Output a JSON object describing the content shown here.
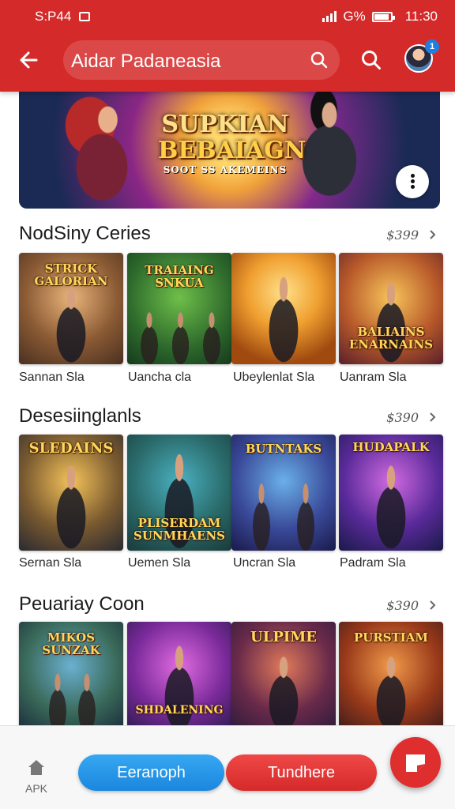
{
  "status_bar": {
    "carrier": "S:P44",
    "time": "11:30",
    "battery": "G%"
  },
  "search": {
    "value": "Aidar Padaneasia"
  },
  "profile": {
    "notification_count": "1"
  },
  "banner": {
    "title_line1": "SUPKIAN",
    "title_line2": "BEBAIAGN",
    "title_line3": "SOOT SS AKEMEINS"
  },
  "sections": [
    {
      "title": "NodSiny Ceries",
      "price": "$399",
      "items": [
        {
          "art_text": "STRICK GALORIAN",
          "caption": "Sannan Sla"
        },
        {
          "art_text": "TRAIAING SNKUA",
          "caption": "Uancha cla"
        },
        {
          "art_text": "",
          "caption": "Ubeylenlat Sla"
        },
        {
          "art_text": "BALIAINS ENARNAINS",
          "caption": "Uanram Sla"
        }
      ]
    },
    {
      "title": "Desesiinglanls",
      "price": "$390",
      "items": [
        {
          "art_text": "SLEDAINS",
          "caption": "Sernan Sla"
        },
        {
          "art_text": "PLISERDAM SUNMHAENS",
          "caption": "Uemen Sla"
        },
        {
          "art_text": "BUTNTAKS",
          "caption": "Uncran Sla"
        },
        {
          "art_text": "HUDAPALK",
          "caption": "Padram Sla"
        }
      ]
    },
    {
      "title": "Peuariay Coon",
      "price": "$390",
      "items": [
        {
          "art_text": "MIKOS SUNZAK",
          "caption": ""
        },
        {
          "art_text": "SHDALENING",
          "caption": ""
        },
        {
          "art_text": "ULPIME",
          "caption": ""
        },
        {
          "art_text": "PURSTIAM",
          "caption": ""
        }
      ]
    }
  ],
  "bottom_bar": {
    "apk_label": "APK",
    "primary_button": "Eeranoph",
    "secondary_button": "Tundhere"
  },
  "colors": {
    "header": "#d52a2a",
    "blue_button": "#1b86de",
    "red_button": "#d62a2a",
    "fab": "#df2e2e"
  },
  "icons": [
    "back-arrow-icon",
    "search-icon",
    "more-icon",
    "chevron-right-icon",
    "home-icon",
    "edit-icon"
  ]
}
